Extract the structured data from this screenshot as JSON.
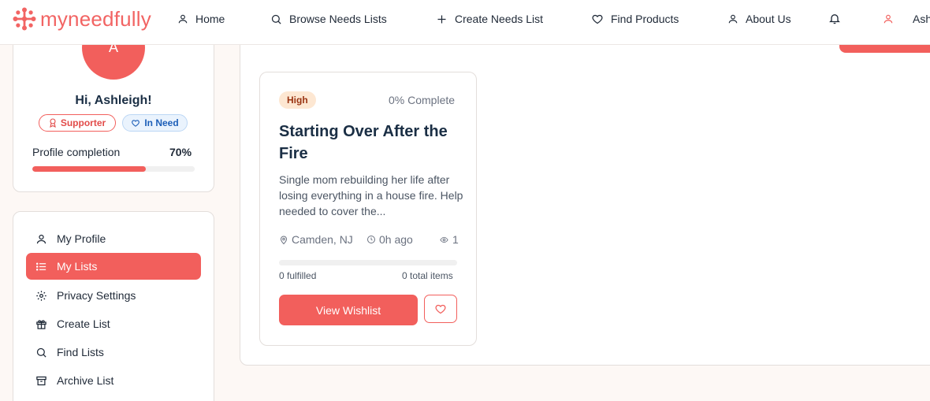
{
  "brand": {
    "name": "myneedfully",
    "accent": "#f25f5c"
  },
  "nav": {
    "home": "Home",
    "browse": "Browse Needs Lists",
    "create": "Create Needs List",
    "find_products": "Find Products",
    "about": "About Us",
    "user_name_partial": "Ash"
  },
  "profile": {
    "avatar_initial": "A",
    "greeting": "Hi, Ashleigh!",
    "badges": {
      "supporter": "Supporter",
      "in_need": "In Need"
    },
    "completion_label": "Profile completion",
    "completion_value": "70%",
    "completion_fraction": 0.7
  },
  "sidebar": {
    "items": [
      {
        "label": "My Profile",
        "icon": "user-icon"
      },
      {
        "label": "My Lists",
        "icon": "list-icon",
        "active": true
      },
      {
        "label": "Privacy Settings",
        "icon": "gear-icon"
      },
      {
        "label": "Create List",
        "icon": "gift-icon"
      },
      {
        "label": "Find Lists",
        "icon": "search-icon"
      },
      {
        "label": "Archive List",
        "icon": "archive-icon"
      }
    ]
  },
  "wishlist": {
    "priority": "High",
    "complete": "0% Complete",
    "title": "Starting Over After the Fire",
    "description": "Single mom rebuilding her life after losing everything in a house fire. Help needed to cover the...",
    "location": "Camden, NJ",
    "time": "0h ago",
    "views": "1",
    "progress_fraction": 0,
    "fulfilled": "0 fulfilled",
    "total": "0 total items",
    "view_button": "View Wishlist"
  }
}
